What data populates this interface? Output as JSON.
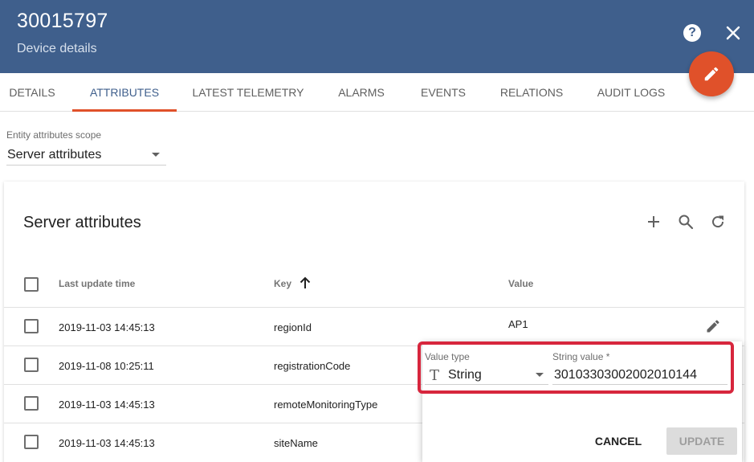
{
  "header": {
    "title": "30015797",
    "subtitle": "Device details",
    "help_glyph": "?",
    "color": "#3f5f8c"
  },
  "fab": {
    "icon": "edit-icon",
    "color": "#e0512a"
  },
  "tabs": [
    {
      "label": "DETAILS",
      "active": false
    },
    {
      "label": "ATTRIBUTES",
      "active": true
    },
    {
      "label": "LATEST TELEMETRY",
      "active": false
    },
    {
      "label": "ALARMS",
      "active": false
    },
    {
      "label": "EVENTS",
      "active": false
    },
    {
      "label": "RELATIONS",
      "active": false
    },
    {
      "label": "AUDIT LOGS",
      "active": false
    }
  ],
  "scope": {
    "label": "Entity attributes scope",
    "value": "Server attributes"
  },
  "card": {
    "title": "Server attributes",
    "tools": [
      "add-icon",
      "search-icon",
      "refresh-icon"
    ]
  },
  "table": {
    "columns": {
      "last_update": "Last update time",
      "key": "Key",
      "value": "Value"
    },
    "sort": {
      "column": "key",
      "direction": "ascending"
    },
    "rows": [
      {
        "time": "2019-11-03 14:45:13",
        "key": "regionId",
        "value": "AP1"
      },
      {
        "time": "2019-11-08 10:25:11",
        "key": "registrationCode",
        "value": ""
      },
      {
        "time": "2019-11-03 14:45:13",
        "key": "remoteMonitoringType",
        "value": ""
      },
      {
        "time": "2019-11-03 14:45:13",
        "key": "siteName",
        "value": ""
      }
    ]
  },
  "edit_popup": {
    "value_type_label": "Value type",
    "value_type": "String",
    "string_value_label": "String value *",
    "string_value": "30103303002002010144",
    "cancel_label": "CANCEL",
    "update_label": "UPDATE"
  },
  "colors": {
    "accent": "#e0512a",
    "highlight": "#d7263d"
  }
}
